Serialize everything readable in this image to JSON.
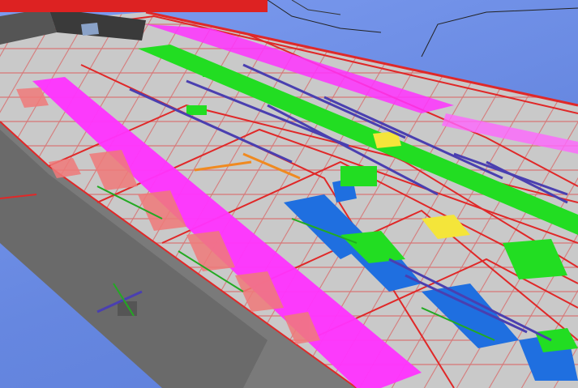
{
  "viewer": {
    "background_color": "#6f8ee6",
    "floor_color": "#c9c9c9",
    "slab_edge_color": "#7a7a7a",
    "wall_color": "#e03030",
    "system_colors": {
      "main_duct": "#ff33ff",
      "secondary_duct": "#22dd22",
      "chilled_water": "#1f6fe0",
      "process_pipe": "#4a3fb0",
      "cable_tray": "#f4e53a",
      "equipment": "#f07a7a",
      "sprinkler": "#f08a20"
    }
  }
}
